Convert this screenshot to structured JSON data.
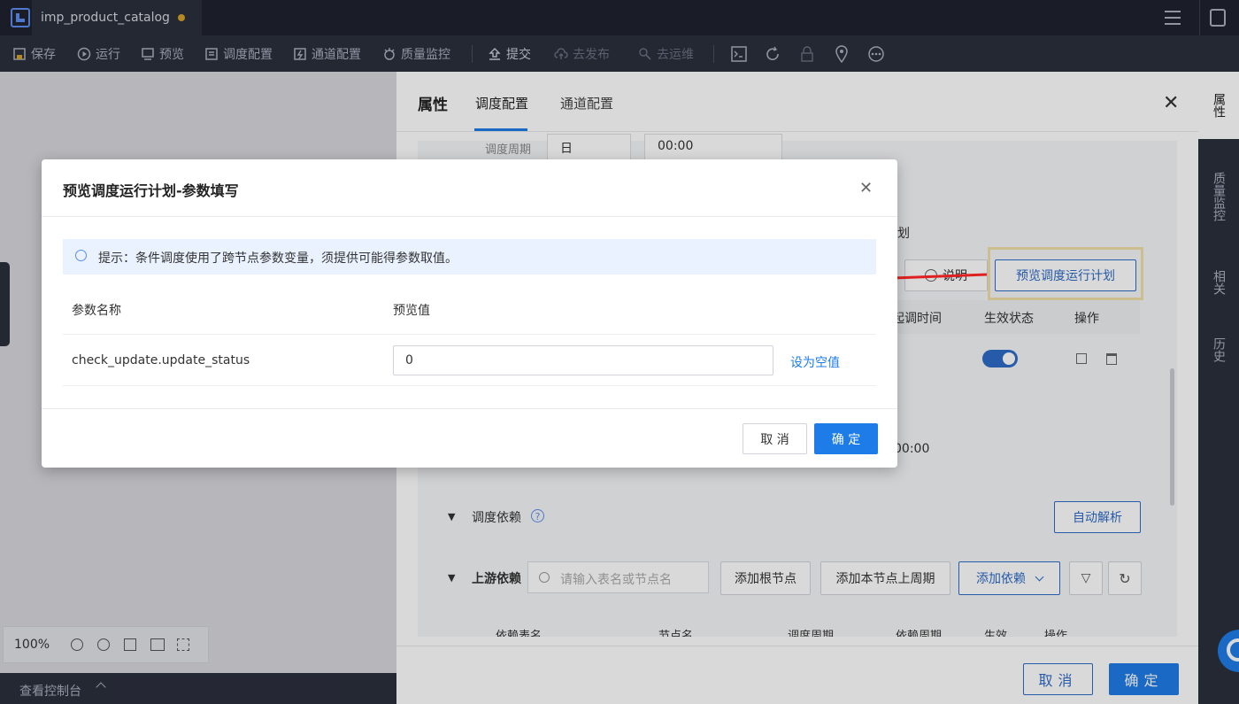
{
  "title_bar": {
    "tab_name": "imp_product_catalog"
  },
  "toolbar": {
    "save": "保存",
    "run": "运行",
    "preview": "预览",
    "schedule_config": "调度配置",
    "channel_config": "通道配置",
    "quality_monitor": "质量监控",
    "submit": "提交",
    "publish": "去发布",
    "ops": "去运维"
  },
  "canvas": {
    "zoom": "100%",
    "console": "查看控制台"
  },
  "panel": {
    "tabs": [
      "属性",
      "调度配置",
      "通道配置"
    ],
    "period_label": "调度周期",
    "period_value": "日",
    "time_value": "00:00",
    "plan_suffix": "划",
    "explain_button": "说明",
    "preview_plan_button": "预览调度运行计划",
    "table_headers": {
      "start_time": "起调时间",
      "status": "生效状态",
      "action": "操作"
    },
    "time_fragment": "00:00",
    "dependency_label": "调度依赖",
    "auto_parse_button": "自动解析",
    "upstream_label": "上游依赖",
    "search_placeholder": "请输入表名或节点名",
    "add_root_button": "添加根节点",
    "add_prev_cycle_button": "添加本节点上周期",
    "add_dependency_button": "添加依赖",
    "dep_headers": [
      "依赖表名",
      "节点名",
      "调度周期",
      "依赖周期",
      "生效",
      "操作"
    ],
    "cancel": "取消",
    "confirm": "确定"
  },
  "rail": {
    "items": [
      "属性",
      "质量监控",
      "相关",
      "历史"
    ]
  },
  "modal": {
    "title": "预览调度运行计划-参数填写",
    "tip": "提示：条件调度使用了跨节点参数变量，须提供可能得参数取值。",
    "col_name": "参数名称",
    "col_value": "预览值",
    "param_name": "check_update.update_status",
    "param_value": "0",
    "set_null": "设为空值",
    "cancel": "取 消",
    "confirm": "确 定"
  },
  "colors": {
    "accent": "#1e7ce8",
    "highlight_border": "#f0e0a8",
    "arrow": "#e02020"
  }
}
